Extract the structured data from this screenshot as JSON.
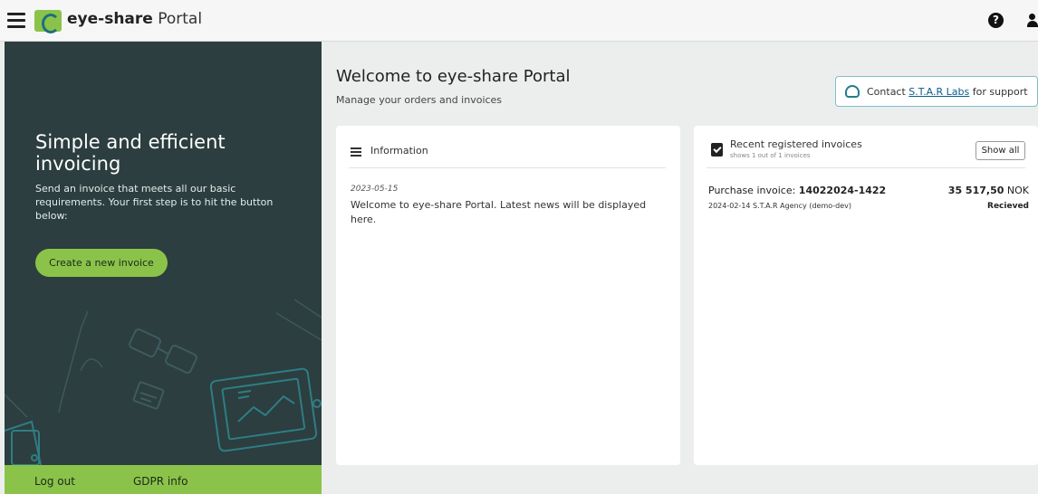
{
  "header": {
    "brand_bold": "eye-share",
    "brand_light": "Portal",
    "help_symbol": "?"
  },
  "sidebar": {
    "title": "Simple and efficient invoicing",
    "text": "Send an invoice that meets all our basic requirements. Your first step is to hit the button below:",
    "create_button": "Create a new invoice",
    "footer": {
      "logout": "Log out",
      "gdpr": "GDPR info"
    }
  },
  "main": {
    "title": "Welcome to eye-share Portal",
    "subtitle": "Manage your orders and invoices",
    "contact": {
      "prefix": "Contact",
      "link": "S.T.A.R Labs",
      "suffix": "for support"
    }
  },
  "information": {
    "title": "Information",
    "news": [
      {
        "date": "2023-05-15",
        "text": "Welcome to eye-share Portal. Latest news will be displayed here."
      }
    ]
  },
  "recent": {
    "title": "Recent registered invoices",
    "count": "shows 1 out of 1 invoices",
    "show_all": "Show all",
    "invoices": [
      {
        "label": "Purchase invoice:",
        "number": "14022024-1422",
        "meta": "2024-02-14 S.T.A.R Agency (demo-dev)",
        "amount": "35 517,50",
        "currency": "NOK",
        "status": "Recieved"
      }
    ]
  },
  "colors": {
    "sidebar_bg": "#2c3e3f",
    "accent_green": "#8bc34a",
    "teal": "#1f7d8b",
    "page_bg": "#eceeee"
  }
}
